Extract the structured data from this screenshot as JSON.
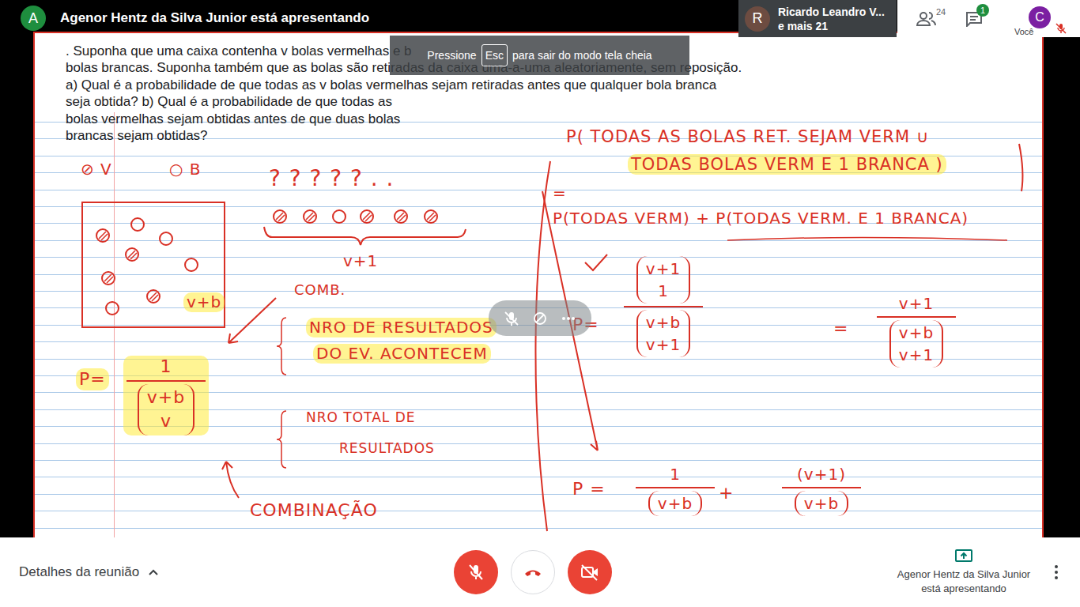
{
  "meeting": {
    "presenter_initial": "A",
    "presenter_banner": "Agenor Hentz da Silva Junior está apresentando"
  },
  "participants_tile": {
    "initial": "R",
    "name": "Ricardo Leandro V...",
    "others": "e mais 21"
  },
  "top_toolbar": {
    "people_count": "24",
    "chat_badge": "1",
    "self_initial": "C",
    "self_label": "Você",
    "self_muted": true
  },
  "toast": {
    "before": "Pressione",
    "key": "Esc",
    "after": "para sair do modo tela cheia"
  },
  "tile_overlay": {
    "mic_muted": true
  },
  "document": {
    "lines": [
      ". Suponha que uma caixa contenha v bolas vermelhas e b",
      "bolas brancas. Suponha também que as bolas são retiradas da caixa uma-a-uma aleatoriamente, sem reposição.",
      "a) Qual é a probabilidade de que todas as v bolas vermelhas sejam retiradas antes que qualquer bola branca",
      "seja obtida? b) Qual é a probabilidade de que todas as",
      "bolas vermelhas sejam obtidas antes de que duas bolas",
      "brancas sejam obtidas?"
    ],
    "notes": [
      {
        "kind": "text",
        "text": "⊘ V",
        "highlighted": false
      },
      {
        "kind": "text",
        "text": "○ B",
        "highlighted": false
      },
      {
        "kind": "text",
        "text": "? ? ? ? ? . .",
        "highlighted": false
      },
      {
        "kind": "text",
        "text": "v+1",
        "highlighted": false
      },
      {
        "kind": "text",
        "text": "v+b",
        "highlighted": true
      },
      {
        "kind": "text",
        "text": "COMB.",
        "highlighted": false
      },
      {
        "kind": "text",
        "text": "NRO DE RESULTADOS",
        "highlighted": true
      },
      {
        "kind": "text",
        "text": "DO EV. ACONTECEM",
        "highlighted": true
      },
      {
        "kind": "text",
        "text": "P=",
        "highlighted": true
      },
      {
        "kind": "frac",
        "num": {
          "kind": "text",
          "text": "1"
        },
        "den": {
          "kind": "binom",
          "top": "v+b",
          "bottom": "v"
        },
        "highlighted": true
      },
      {
        "kind": "text",
        "text": "NRO TOTAL DE",
        "highlighted": false
      },
      {
        "kind": "text",
        "text": "RESULTADOS",
        "highlighted": false
      },
      {
        "kind": "text",
        "text": "COMBINAÇÃO",
        "highlighted": false
      },
      {
        "kind": "text",
        "text": "P( TODAS AS BOLAS RET. SEJAM VERM ∪",
        "highlighted": false
      },
      {
        "kind": "text",
        "text": "TODAS BOLAS VERM E 1 BRANCA )",
        "highlighted": true
      },
      {
        "kind": "text",
        "text": "=",
        "highlighted": false
      },
      {
        "kind": "text",
        "text": "P(TODAS VERM) + P(TODAS VERM. E 1 BRANCA)",
        "highlighted": false
      },
      {
        "kind": "text",
        "text": "P=",
        "highlighted": false
      },
      {
        "kind": "frac",
        "num": {
          "kind": "binom",
          "top": "v+1",
          "bottom": "1"
        },
        "den": {
          "kind": "binom",
          "top": "v+b",
          "bottom": "v+1"
        },
        "highlighted": false
      },
      {
        "kind": "text",
        "text": "=",
        "highlighted": false
      },
      {
        "kind": "frac",
        "num": {
          "kind": "text",
          "text": "v+1"
        },
        "den": {
          "kind": "binom",
          "top": "v+b",
          "bottom": "v+1"
        },
        "highlighted": false
      },
      {
        "kind": "text",
        "text": "P =",
        "highlighted": false
      },
      {
        "kind": "frac",
        "num": {
          "kind": "text",
          "text": "1"
        },
        "den": {
          "kind": "binom",
          "top": "v+b",
          "bottom": ""
        },
        "highlighted": false
      },
      {
        "kind": "text",
        "text": "+",
        "highlighted": false
      },
      {
        "kind": "frac",
        "num": {
          "kind": "text",
          "text": "(v+1)"
        },
        "den": {
          "kind": "binom",
          "top": "v+b",
          "bottom": ""
        },
        "highlighted": false
      }
    ]
  },
  "bottom_bar": {
    "details_label": "Detalhes da reunião",
    "mic_muted": true,
    "camera_off": true,
    "presenting_label": "Agenor Hentz da Silva Junior está apresentando"
  }
}
